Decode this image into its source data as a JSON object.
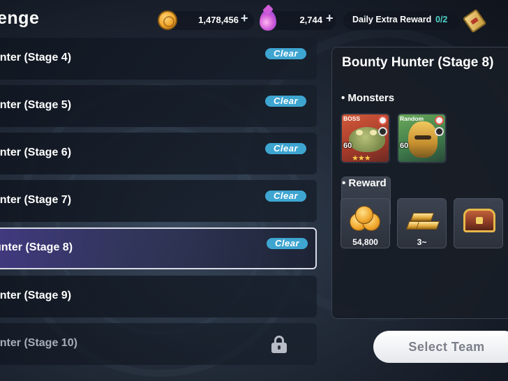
{
  "header": {
    "title": "enge",
    "gold": "1,478,456",
    "gems": "2,744",
    "plus": "+",
    "daily_label": "Daily Extra Reward",
    "daily_count": "0/2"
  },
  "stages": [
    {
      "label": "unter (Stage 4)",
      "status": "Clear"
    },
    {
      "label": "unter (Stage 5)",
      "status": "Clear"
    },
    {
      "label": "unter (Stage 6)",
      "status": "Clear"
    },
    {
      "label": "unter (Stage 7)",
      "status": "Clear"
    },
    {
      "label": "unter (Stage 8)",
      "status": "Clear"
    },
    {
      "label": "unter (Stage 9)",
      "status": ""
    },
    {
      "label": "unter (Stage 10)",
      "status": "locked"
    }
  ],
  "detail": {
    "title": "Bounty Hunter (Stage 8)",
    "monsters_heading": "• Monsters",
    "monsters": [
      {
        "tag": "BOSS",
        "level": "60",
        "stars": "★★★",
        "icon": "frog-boss"
      },
      {
        "tag": "Random",
        "level": "60",
        "icon": "masked-warrior"
      }
    ],
    "reward_heading": "• Reward",
    "rewards": [
      {
        "icon": "gold-coins-icon",
        "value": "54,800"
      },
      {
        "icon": "gold-bars-icon",
        "value": "3~"
      },
      {
        "icon": "treasure-chest-icon",
        "value": ""
      }
    ]
  },
  "action": {
    "select_team_label": "Select Team"
  },
  "colors": {
    "clear_badge": "#3ea5d1",
    "daily_count": "#4fd3c9",
    "selected_border": "#d9dbe8"
  }
}
